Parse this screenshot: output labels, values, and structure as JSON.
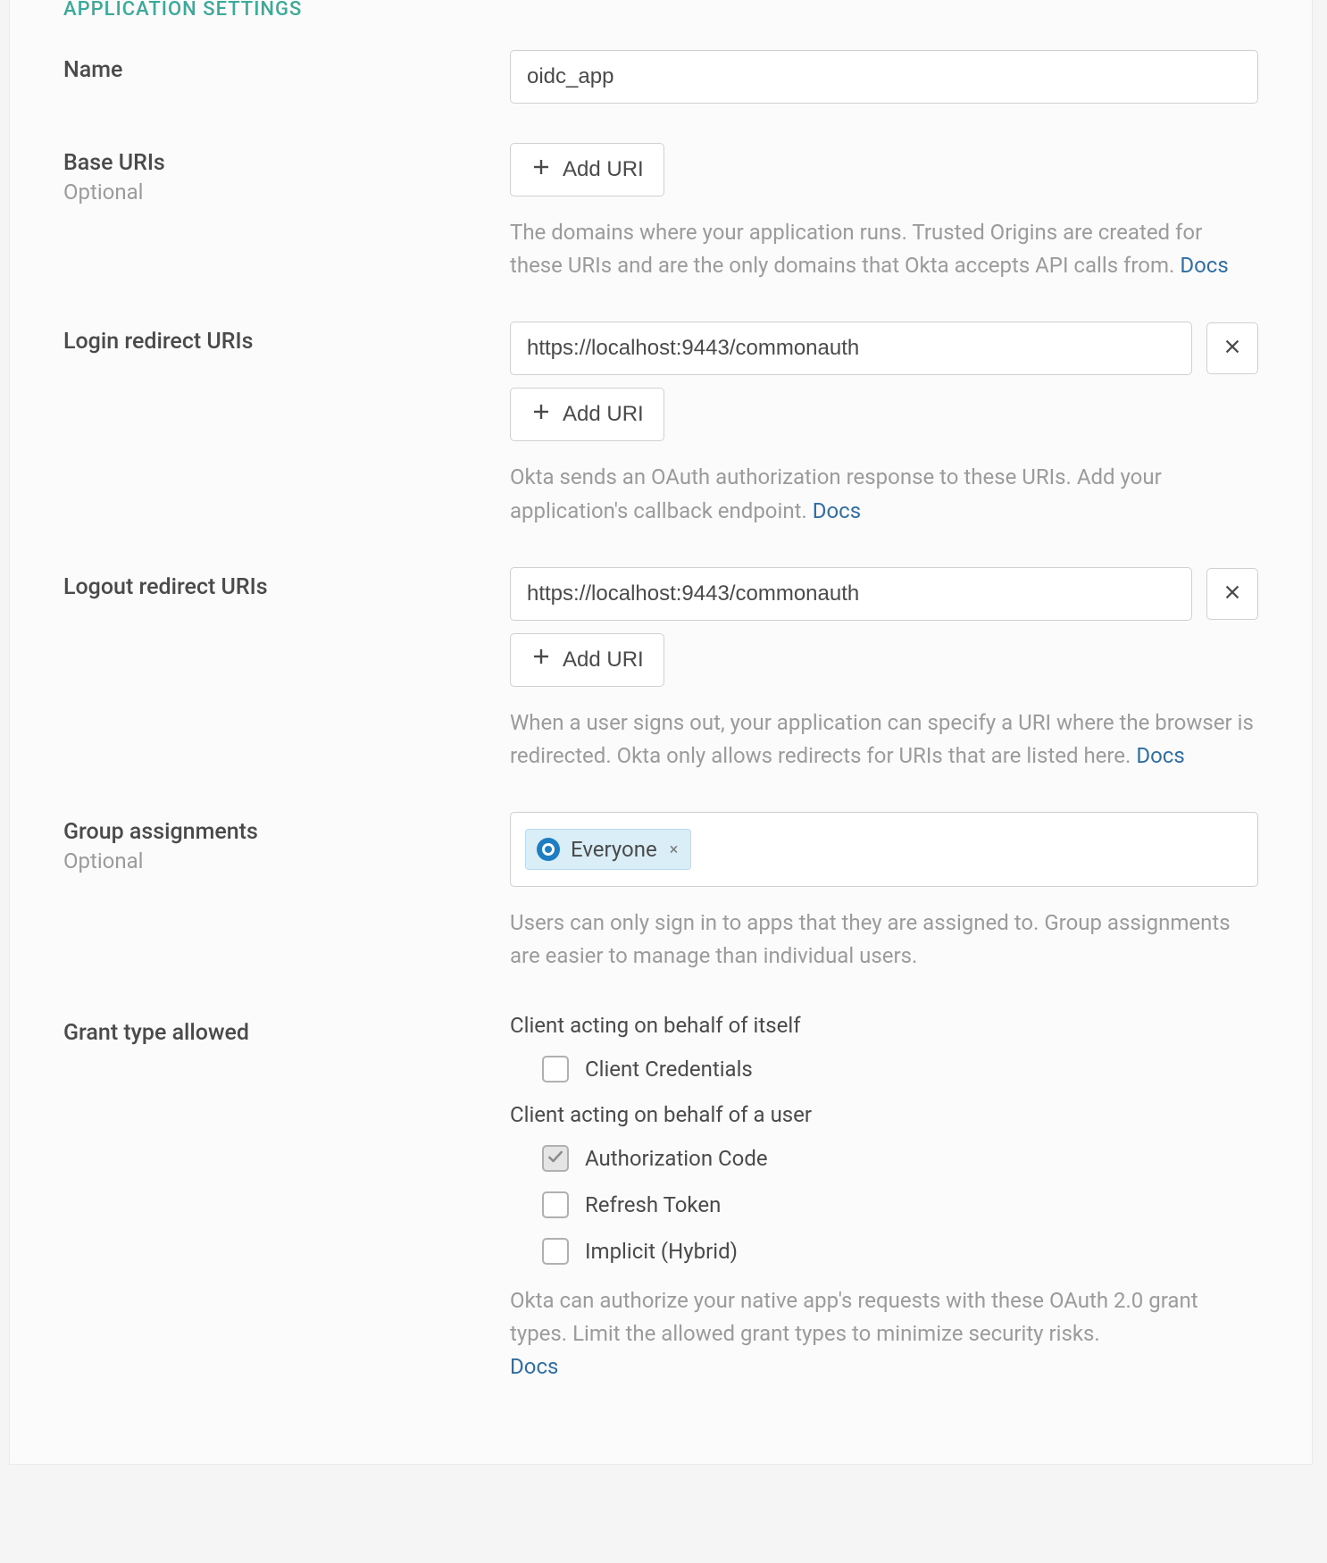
{
  "section_title": "APPLICATION SETTINGS",
  "labels": {
    "name": "Name",
    "base_uris": "Base URIs",
    "optional": "Optional",
    "login_redirect_uris": "Login redirect URIs",
    "logout_redirect_uris": "Logout redirect URIs",
    "group_assignments": "Group assignments",
    "grant_type_allowed": "Grant type allowed"
  },
  "values": {
    "name": "oidc_app",
    "login_redirect_uri_0": "https://localhost:9443/commonauth",
    "logout_redirect_uri_0": "https://localhost:9443/commonauth"
  },
  "buttons": {
    "add_uri": "Add URI"
  },
  "help": {
    "base_uris": "The domains where your application runs. Trusted Origins are created for these URIs and are the only domains that Okta accepts API calls from. ",
    "login_redirect": "Okta sends an OAuth authorization response to these URIs. Add your application's callback endpoint. ",
    "logout_redirect": "When a user signs out, your application can specify a URI where the browser is redirected. Okta only allows redirects for URIs that are listed here. ",
    "group_assignments": "Users can only sign in to apps that they are assigned to. Group assignments are easier to manage than individual users.",
    "grant_types": "Okta can authorize your native app's requests with these OAuth 2.0 grant types. Limit the allowed grant types to minimize security risks. ",
    "docs": "Docs"
  },
  "tags": {
    "everyone": "Everyone"
  },
  "grant": {
    "self_heading": "Client acting on behalf of itself",
    "user_heading": "Client acting on behalf of a user",
    "client_credentials": "Client Credentials",
    "authorization_code": "Authorization Code",
    "refresh_token": "Refresh Token",
    "implicit_hybrid": "Implicit (Hybrid)"
  }
}
